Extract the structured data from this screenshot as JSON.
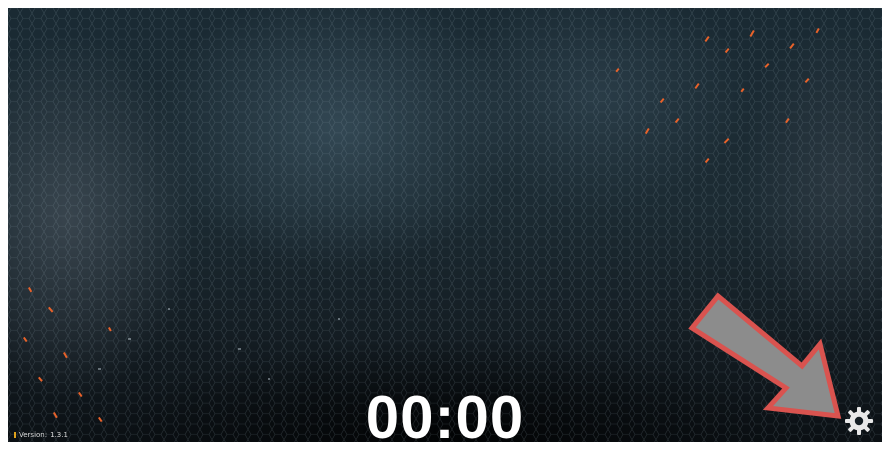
{
  "screen": {
    "timer_text": "00:00",
    "version_label": "Version:",
    "version_number": "1.3.1"
  },
  "settings": {
    "icon": "gear-icon"
  },
  "annotation": {
    "icon": "pointer-arrow",
    "fill_color": "#8c8c8c",
    "stroke_color": "#d9534f"
  },
  "colors": {
    "timer_text": "#ffffff",
    "background": "#1c2b33",
    "spark": "#e8622a"
  }
}
